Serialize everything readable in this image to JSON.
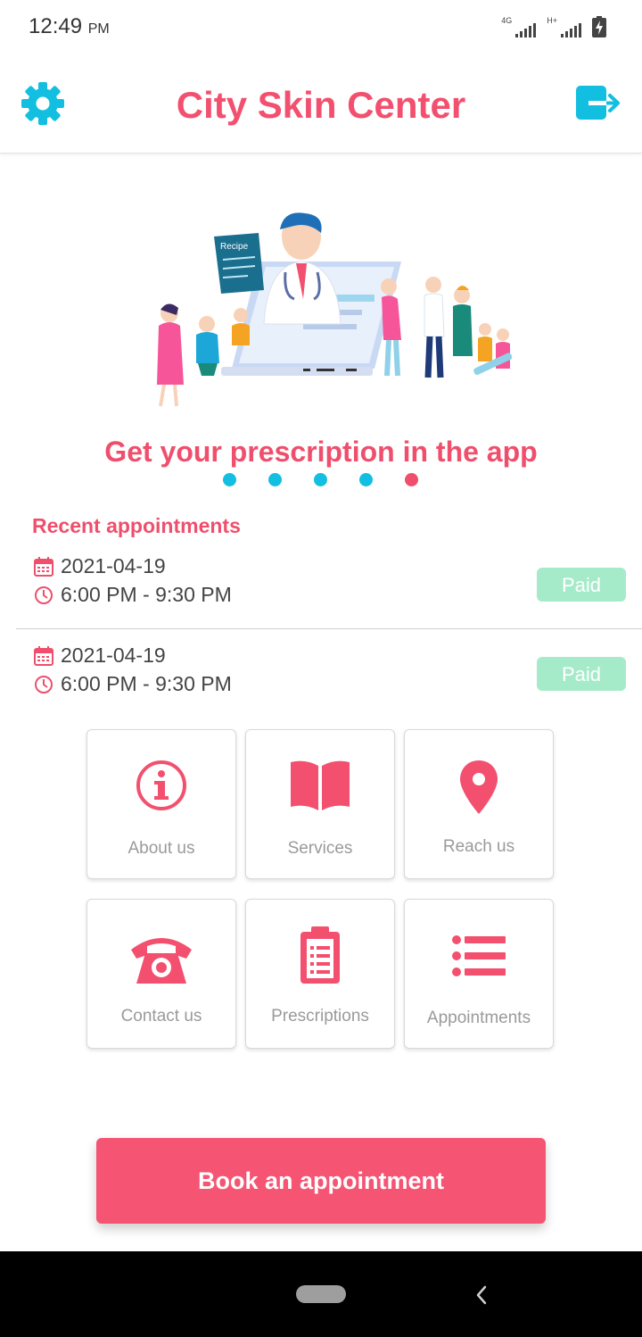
{
  "status_bar": {
    "time": "12:49",
    "ampm": "PM",
    "network_1": "4G",
    "network_2": "H+"
  },
  "header": {
    "title": "City Skin Center",
    "settings_icon": "gear-icon",
    "logout_icon": "logout-icon"
  },
  "carousel": {
    "illustration_label": "Recipe",
    "caption": "Get your prescription in the app",
    "dot_count": 5,
    "active_index": 4
  },
  "recent": {
    "title": "Recent appointments",
    "items": [
      {
        "date": "2021-04-19",
        "time": "6:00 PM - 9:30 PM",
        "status": "Paid"
      },
      {
        "date": "2021-04-19",
        "time": "6:00 PM - 9:30 PM",
        "status": "Paid"
      }
    ]
  },
  "menu": {
    "about": "About us",
    "services": "Services",
    "reach": "Reach us",
    "contact": "Contact us",
    "prescriptions": "Prescriptions",
    "appointments": "Appointments"
  },
  "book_button": "Book an appointment",
  "colors": {
    "accent": "#f2506e",
    "secondary": "#12bfe0",
    "paid": "#a6ebc9"
  }
}
